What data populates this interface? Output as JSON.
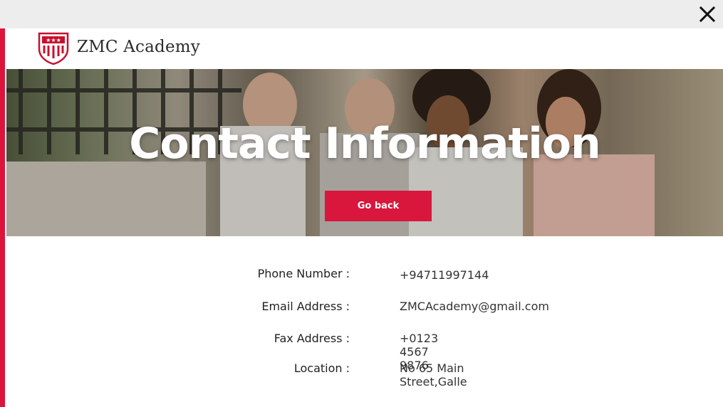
{
  "window": {
    "close_icon": "close-icon"
  },
  "header": {
    "brand": "ZMC Academy",
    "logo_icon": "shield-crest-icon",
    "accent_color": "#dc143c"
  },
  "hero": {
    "title": "Contact Information",
    "button_label": "Go back",
    "button_color": "#d9163c"
  },
  "contact": {
    "items": [
      {
        "label": "Phone Number :",
        "value": "+94711997144"
      },
      {
        "label": "Email Address :",
        "value": "ZMCAcademy@gmail.com"
      },
      {
        "label": "Fax Address :",
        "value": "+0123 4567 9876"
      },
      {
        "label": "Location :",
        "value": "No 65 Main Street,Galle"
      }
    ]
  }
}
